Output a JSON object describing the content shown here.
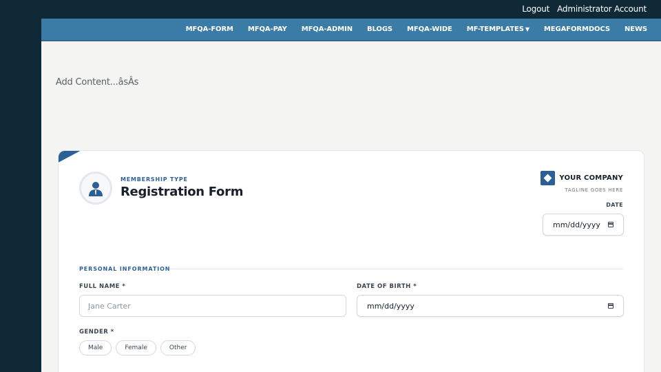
{
  "topbar": {
    "logout": "Logout",
    "account": "Administrator Account"
  },
  "nav": {
    "items": [
      "MFQA-FORM",
      "MFQA-PAY",
      "MFQA-ADMIN",
      "BLOGS",
      "MFQA-WIDE",
      "MF-TEMPLATES",
      "MEGAFORMDOCS",
      "NEWS"
    ],
    "dropdown_caret": "▼"
  },
  "page": {
    "add_content": "Add Content...âsÂs"
  },
  "form": {
    "membership_type": "MEMBERSHIP TYPE",
    "title": "Registration Form",
    "company_name": "YOUR COMPANY",
    "tagline": "TAGLINE GOES HERE",
    "date_label": "DATE",
    "date_value": "mm/dd/yyyy",
    "section_personal": "PERSONAL INFORMATION",
    "full_name_label": "FULL NAME *",
    "full_name_placeholder": "Jane Carter",
    "dob_label": "DATE OF BIRTH *",
    "dob_value": "mm/dd/yyyy",
    "gender_label": "GENDER *",
    "gender_options": [
      "Male",
      "Female",
      "Other"
    ]
  },
  "colors": {
    "dark_bg": "#0f2a36",
    "nav_bg": "#3a7ca5",
    "accent": "#2c5f96"
  }
}
